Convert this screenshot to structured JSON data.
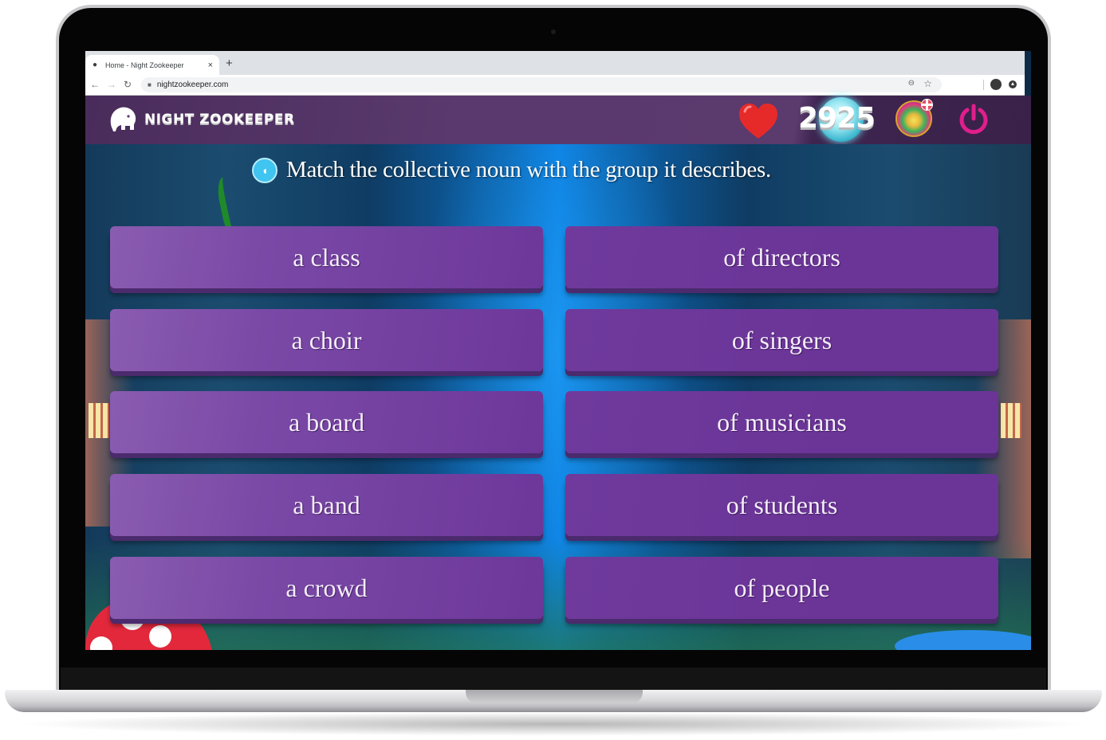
{
  "browser": {
    "tab_title": "Home - Night Zookeeper",
    "tab_close": "×",
    "new_tab": "+",
    "back": "←",
    "forward": "→",
    "reload": "↻",
    "lock": "🔒",
    "url": "nightzookeeper.com",
    "zoom_icon": "⊖",
    "bookmark": "☆"
  },
  "header": {
    "logo_text": "NIGHT ZOOKEEPER",
    "score": "2925",
    "colors": {
      "heart": "#e62a2a",
      "power": "#e01e8c",
      "header_bg": "#5a3a6e"
    }
  },
  "game": {
    "question": "Match the collective noun with the group it describes.",
    "sound_glyph": "◖",
    "left_items": [
      "a class",
      "a choir",
      "a board",
      "a band",
      "a crowd"
    ],
    "right_items": [
      "of directors",
      "of singers",
      "of musicians",
      "of students",
      "of people"
    ],
    "colors": {
      "card": "#6d379a",
      "card_shadow": "#4b2a6d"
    }
  }
}
